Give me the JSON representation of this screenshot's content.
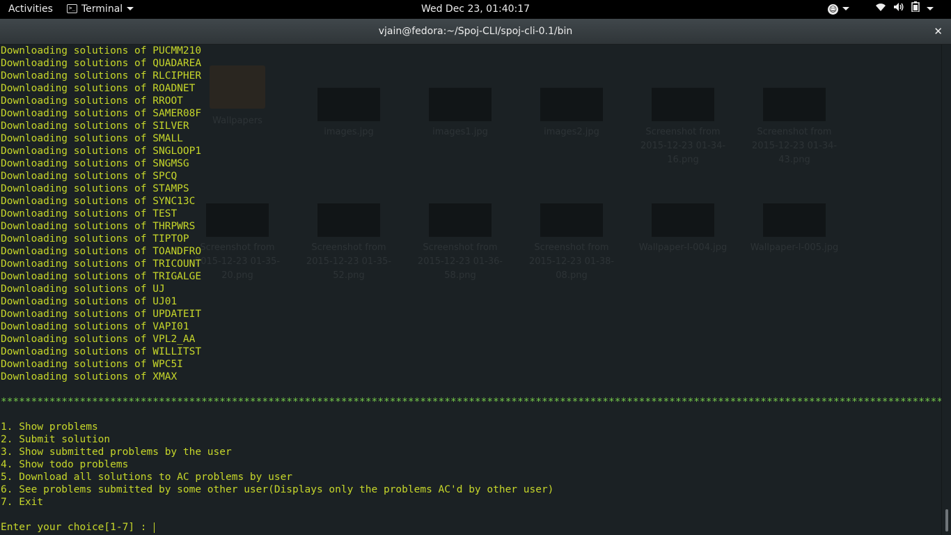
{
  "topbar": {
    "activities": "Activities",
    "app_name": "Terminal",
    "clock": "Wed Dec 23, 01:40:17"
  },
  "window": {
    "title": "vjain@fedora:~/Spoj-CLI/spoj-cli-0.1/bin",
    "close_glyph": "✕"
  },
  "terminal": {
    "download_prefix": "Downloading solutions of ",
    "downloads": [
      "PUCMM210",
      "QUADAREA",
      "RLCIPHER",
      "ROADNET",
      "RROOT",
      "SAMER08F",
      "SILVER",
      "SMALL",
      "SNGLOOP1",
      "SNGMSG",
      "SPCQ",
      "STAMPS",
      "SYNC13C",
      "TEST",
      "THRPWRS",
      "TIPTOP",
      "TOANDFRO",
      "TRICOUNT",
      "TRIGALGE",
      "UJ",
      "UJ01",
      "UPDATEIT",
      "VAPI01",
      "VPL2_AA",
      "WILLITST",
      "WPC5I",
      "XMAX"
    ],
    "separator": "**************************************************************************************************************************************************************",
    "menu": [
      "1. Show problems",
      "2. Submit solution",
      "3. Show submitted problems by the user",
      "4. Show todo problems",
      "5. Download all solutions to AC problems by user",
      "6. See problems submitted by some other user(Displays only the problems AC'd by other user)",
      "7. Exit"
    ],
    "prompt": "Enter your choice[1-7] : ",
    "text_color": "#c7d72a",
    "separator_color": "#76cc4a",
    "background": "#1b2124"
  },
  "background_files": [
    {
      "name": "Wallpapers",
      "kind": "folder-icon"
    },
    {
      "name": "images.jpg"
    },
    {
      "name": "images1.jpg"
    },
    {
      "name": "images2.jpg"
    },
    {
      "name": "Screenshot from 2015-12-23 01-34-16.png"
    },
    {
      "name": "Screenshot from 2015-12-23 01-34-43.png"
    },
    {
      "name": "Screenshot from 2015-12-23 01-35-20.png"
    },
    {
      "name": "Screenshot from 2015-12-23 01-35-52.png"
    },
    {
      "name": "Screenshot from 2015-12-23 01-36-58.png"
    },
    {
      "name": "Screenshot from 2015-12-23 01-38-08.png"
    },
    {
      "name": "Wallpaper-I-004.jpg"
    },
    {
      "name": "Wallpaper-I-005.jpg"
    }
  ],
  "icons": {
    "accessibility": "accessibility-icon",
    "wifi": "wifi-icon",
    "volume": "volume-icon",
    "battery": "battery-icon",
    "close": "close-icon"
  }
}
